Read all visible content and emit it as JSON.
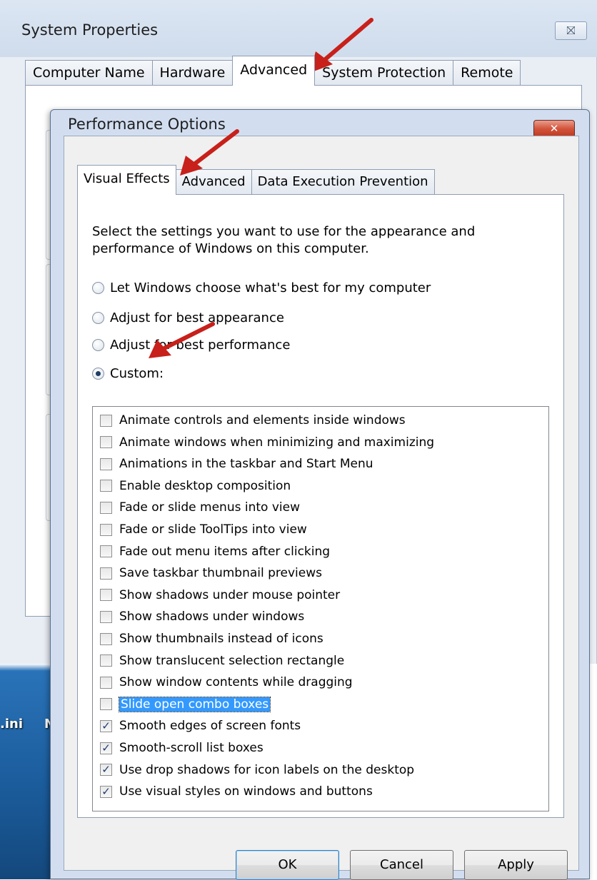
{
  "system_properties": {
    "title": "System Properties",
    "close_glyph": "⛝",
    "tabs": [
      {
        "label": "Computer Name",
        "active": false
      },
      {
        "label": "Hardware",
        "active": false
      },
      {
        "label": "Advanced",
        "active": true
      },
      {
        "label": "System Protection",
        "active": false
      },
      {
        "label": "Remote",
        "active": false
      }
    ]
  },
  "performance_options": {
    "title": "Performance Options",
    "close_glyph": "✕",
    "tabs": [
      {
        "label": "Visual Effects",
        "active": true
      },
      {
        "label": "Advanced",
        "active": false
      },
      {
        "label": "Data Execution Prevention",
        "active": false
      }
    ],
    "intro": "Select the settings you want to use for the appearance and performance of Windows on this computer.",
    "radio_options": [
      {
        "label": "Let Windows choose what's best for my computer",
        "checked": false
      },
      {
        "label": "Adjust for best appearance",
        "checked": false
      },
      {
        "label": "Adjust for best performance",
        "checked": false
      },
      {
        "label": "Custom:",
        "checked": true
      }
    ],
    "effects": [
      {
        "label": "Animate controls and elements inside windows",
        "checked": false
      },
      {
        "label": "Animate windows when minimizing and maximizing",
        "checked": false
      },
      {
        "label": "Animations in the taskbar and Start Menu",
        "checked": false
      },
      {
        "label": "Enable desktop composition",
        "checked": false
      },
      {
        "label": "Fade or slide menus into view",
        "checked": false
      },
      {
        "label": "Fade or slide ToolTips into view",
        "checked": false
      },
      {
        "label": "Fade out menu items after clicking",
        "checked": false
      },
      {
        "label": "Save taskbar thumbnail previews",
        "checked": false
      },
      {
        "label": "Show shadows under mouse pointer",
        "checked": false
      },
      {
        "label": "Show shadows under windows",
        "checked": false
      },
      {
        "label": "Show thumbnails instead of icons",
        "checked": false
      },
      {
        "label": "Show translucent selection rectangle",
        "checked": false
      },
      {
        "label": "Show window contents while dragging",
        "checked": false
      },
      {
        "label": "Slide open combo boxes",
        "checked": false,
        "selected": true
      },
      {
        "label": "Smooth edges of screen fonts",
        "checked": true
      },
      {
        "label": "Smooth-scroll list boxes",
        "checked": true
      },
      {
        "label": "Use drop shadows for icon labels on the desktop",
        "checked": true
      },
      {
        "label": "Use visual styles on windows and buttons",
        "checked": true
      }
    ],
    "buttons": {
      "ok": "OK",
      "cancel": "Cancel",
      "apply": "Apply"
    }
  },
  "desktop": {
    "label_1": ".ini",
    "label_2": "N"
  },
  "colors": {
    "annotation_arrow": "#c8201a",
    "selection": "#3399ff",
    "close_red": "#c0381f"
  }
}
